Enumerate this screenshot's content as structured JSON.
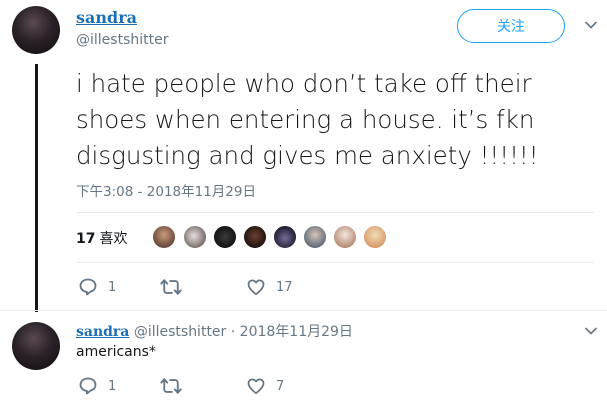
{
  "tweet": {
    "display_name": "sandra",
    "handle": "@illestshitter",
    "follow_label": "关注",
    "text_lines": [
      "i hate people who don’t take off their",
      "shoes when entering a house. it’s fkn",
      "disgusting and gives me anxiety !!!!!!"
    ],
    "timestamp": "下午3:08 - 2018年11月29日",
    "likes_count": "17",
    "likes_label": "喜欢",
    "liker_avatars": [
      "liker-1",
      "liker-2",
      "liker-3",
      "liker-4",
      "liker-5",
      "liker-6",
      "liker-7",
      "liker-8",
      "liker-9"
    ],
    "actions": {
      "reply_count": "1",
      "retweet_count": "",
      "like_count": "17"
    }
  },
  "reply": {
    "display_name": "sandra",
    "handle": "@illestshitter",
    "separator": " · ",
    "date": "2018年11月29日",
    "text": "americans*",
    "actions": {
      "reply_count": "1",
      "retweet_count": "",
      "like_count": "7"
    }
  },
  "colors": {
    "accent": "#1da1f2",
    "name_link": "#1b6fb4",
    "muted": "#657786",
    "divider": "#e6ecf0"
  },
  "icons": [
    "reply-icon",
    "retweet-icon",
    "heart-icon",
    "chevron-down-icon"
  ]
}
